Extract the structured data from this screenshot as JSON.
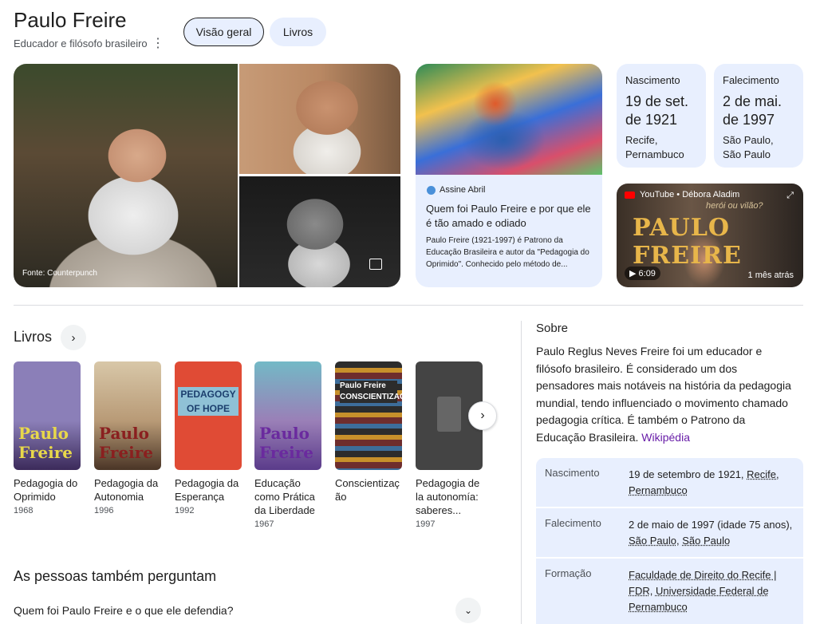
{
  "header": {
    "title": "Paulo Freire",
    "subtitle": "Educador e filósofo brasileiro",
    "tabs": [
      {
        "label": "Visão geral",
        "active": true
      },
      {
        "label": "Livros",
        "active": false
      }
    ]
  },
  "photos": {
    "credit": "Fonte: Counterpunch"
  },
  "article": {
    "source": "Assine Abril",
    "title": "Quem foi Paulo Freire e por que ele é tão amado e odiado",
    "snippet": "Paulo Freire (1921-1997) é Patrono da Educação Brasileira e autor da \"Pedagogia do Oprimido\". Conhecido pelo método de..."
  },
  "facts": [
    {
      "label": "Nascimento",
      "date": "19 de set. de 1921",
      "place": "Recife, Pernambuco"
    },
    {
      "label": "Falecimento",
      "date": "2 de mai. de 1997",
      "place": "São Paulo, São Paulo"
    }
  ],
  "video": {
    "channel": "YouTube • Débora Aladim",
    "overlay_big": "PAULO FREIRE",
    "overlay_small": "herói ou vilão?",
    "duration": "6:09",
    "ago": "1 mês atrás"
  },
  "books_section": {
    "heading": "Livros",
    "books": [
      {
        "title": "Pedagogia do Oprimido",
        "year": "1968",
        "cover_text": "Paulo Freire"
      },
      {
        "title": "Pedagogia da Autonomia",
        "year": "1996",
        "cover_text": "Paulo Freire"
      },
      {
        "title": "Pedagogia da Esperança",
        "year": "1992",
        "cover_text": "PEDAGOGY OF HOPE"
      },
      {
        "title": "Educação como Prática da Liberdade",
        "year": "1967",
        "cover_text": "Paulo Freire"
      },
      {
        "title": "Conscientização",
        "year": "",
        "cover_text": "Paulo Freire CONSCIENTIZAÇÃO"
      },
      {
        "title": "Pedagogia de la autonomía: saberes...",
        "year": "1997",
        "cover_text": ""
      }
    ]
  },
  "paa": {
    "heading": "As pessoas também perguntam",
    "question": "Quem foi Paulo Freire e o que ele defendia?"
  },
  "about": {
    "heading": "Sobre",
    "text": "Paulo Reglus Neves Freire foi um educador e filósofo brasileiro. É considerado um dos pensadores mais notáveis na história da pedagogia mundial, tendo influenciado o movimento chamado pedagogia crítica. É também o Patrono da Educação Brasileira.",
    "source": "Wikipédia",
    "info": [
      {
        "key": "Nascimento",
        "value_pre": "19 de setembro de 1921, ",
        "links": [
          "Recife",
          "Pernambuco"
        ]
      },
      {
        "key": "Falecimento",
        "value_pre": "2 de maio de 1997 (idade 75 anos),",
        "links": [
          "São Paulo",
          "São Paulo"
        ]
      },
      {
        "key": "Formação",
        "value_pre": "",
        "links": [
          "Faculdade de Direito do Recife | FDR",
          "Universidade Federal de Pernambuco"
        ]
      }
    ]
  },
  "colors": {
    "card_bg": "#e8effe",
    "link_visited": "#681da8",
    "text": "#1f1f1f"
  }
}
